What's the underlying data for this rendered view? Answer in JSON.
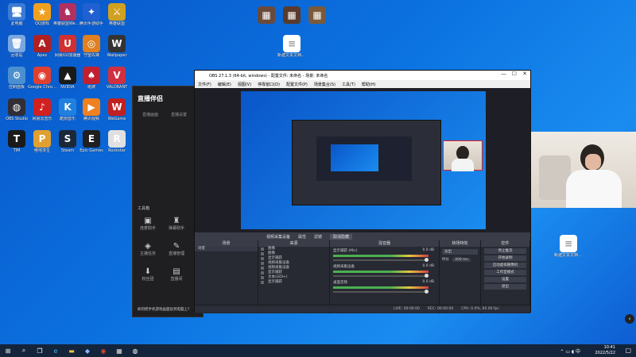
{
  "desktop": {
    "icons": [
      {
        "label": "此电脑",
        "glyph": "🖥",
        "color": "#3a7bd5"
      },
      {
        "label": "QQ游戏",
        "glyph": "★",
        "color": "#f0a020"
      },
      {
        "label": "英雄联盟WeGame",
        "glyph": "♞",
        "color": "#b03060"
      },
      {
        "label": "腾讯手游助手",
        "glyph": "✦",
        "color": "#2060d0"
      },
      {
        "label": "英雄联盟",
        "glyph": "⚔",
        "color": "#d0a020"
      },
      {
        "label": "回收站",
        "glyph": "🗑",
        "color": "#7aa7e0"
      },
      {
        "label": "Apex",
        "glyph": "A",
        "color": "#b02020"
      },
      {
        "label": "网易UU加速器",
        "glyph": "U",
        "color": "#d03030"
      },
      {
        "label": "守望先锋",
        "glyph": "◎",
        "color": "#e08020"
      },
      {
        "label": "Wallpaper",
        "glyph": "W",
        "color": "#333"
      },
      {
        "label": "控制面板",
        "glyph": "⚙",
        "color": "#4a90d0"
      },
      {
        "label": "Google Chrome",
        "glyph": "◉",
        "color": "#e04030"
      },
      {
        "label": "NVIDIA",
        "glyph": "▲",
        "color": "#1a1a1a"
      },
      {
        "label": "纸牌",
        "glyph": "♠",
        "color": "#c02030"
      },
      {
        "label": "VALORANT",
        "glyph": "V",
        "color": "#d03040"
      },
      {
        "label": "OBS Studio",
        "glyph": "◍",
        "color": "#302e36"
      },
      {
        "label": "网易云音乐",
        "glyph": "♪",
        "color": "#d02020"
      },
      {
        "label": "酷狗音乐",
        "glyph": "K",
        "color": "#2080e0"
      },
      {
        "label": "腾讯视频",
        "glyph": "▶",
        "color": "#f08020"
      },
      {
        "label": "WeGame",
        "glyph": "W",
        "color": "#c02020"
      },
      {
        "label": "TIM",
        "glyph": "T",
        "color": "#1a1a1a"
      },
      {
        "label": "绝地求生",
        "glyph": "P",
        "color": "#e0a030"
      },
      {
        "label": "Steam",
        "glyph": "S",
        "color": "#1b2838"
      },
      {
        "label": "Epic Games",
        "glyph": "E",
        "color": "#202020"
      },
      {
        "label": "Rockstar",
        "glyph": "R",
        "color": "#e0e0e0"
      }
    ]
  },
  "obs": {
    "title": "OBS 27.1.3 (64-bit, windows) - 配置文件: 未命名 - 场景: 未命名",
    "menu": [
      "文件(F)",
      "编辑(E)",
      "视图(V)",
      "停靠窗口(D)",
      "配置文件(P)",
      "场景集合(S)",
      "工具(T)",
      "帮助(H)"
    ],
    "toolstrip": [
      "视频采集设备",
      "属性",
      "滤镜",
      "取消隐藏"
    ],
    "docks": {
      "scenes": "场景",
      "sources": "来源",
      "mixer": "混音器",
      "transitions": "转场特效",
      "controls": "控件"
    },
    "scene_items": [
      "场景"
    ],
    "source_items": [
      "图像",
      "图像",
      "显示捕获",
      "视频采集设备",
      "视频采集设备",
      "显示捕获",
      "文本(GDI+)",
      "显示捕获"
    ],
    "mixer_channels": [
      {
        "name": "显示捕获 (Mic)",
        "db": "0.0 dB"
      },
      {
        "name": "视频采集设备",
        "db": "0.0 dB"
      },
      {
        "name": "桌面音频",
        "db": "0.0 dB"
      }
    ],
    "transition": {
      "type": "淡出",
      "duration_label": "时长",
      "duration": "300 ms"
    },
    "controls": [
      "停止推流",
      "开始录制",
      "启动虚拟摄像机",
      "工作室模式",
      "设置",
      "退出"
    ],
    "status": [
      "LIVE: 00:00:00",
      "REC: 00:00:00",
      "CPU: 0.0%, 60.00 fps"
    ]
  },
  "live_app": {
    "brand": "直播伴侣",
    "tab1": "直播画面",
    "tab2": "直播设置",
    "tools_title": "工具箱",
    "tools": [
      "连麦助手",
      "弹幕助手",
      "主播任务",
      "直播管理",
      "粉丝团",
      "直播间"
    ],
    "tip": "如何把手机游戏画面投到电脑上?"
  },
  "desktop_files": [
    "新建文本文档.txt",
    "新建文本文档 (2).txt"
  ],
  "taskbar": {
    "time": "10:41",
    "date": "2022/5/22"
  }
}
